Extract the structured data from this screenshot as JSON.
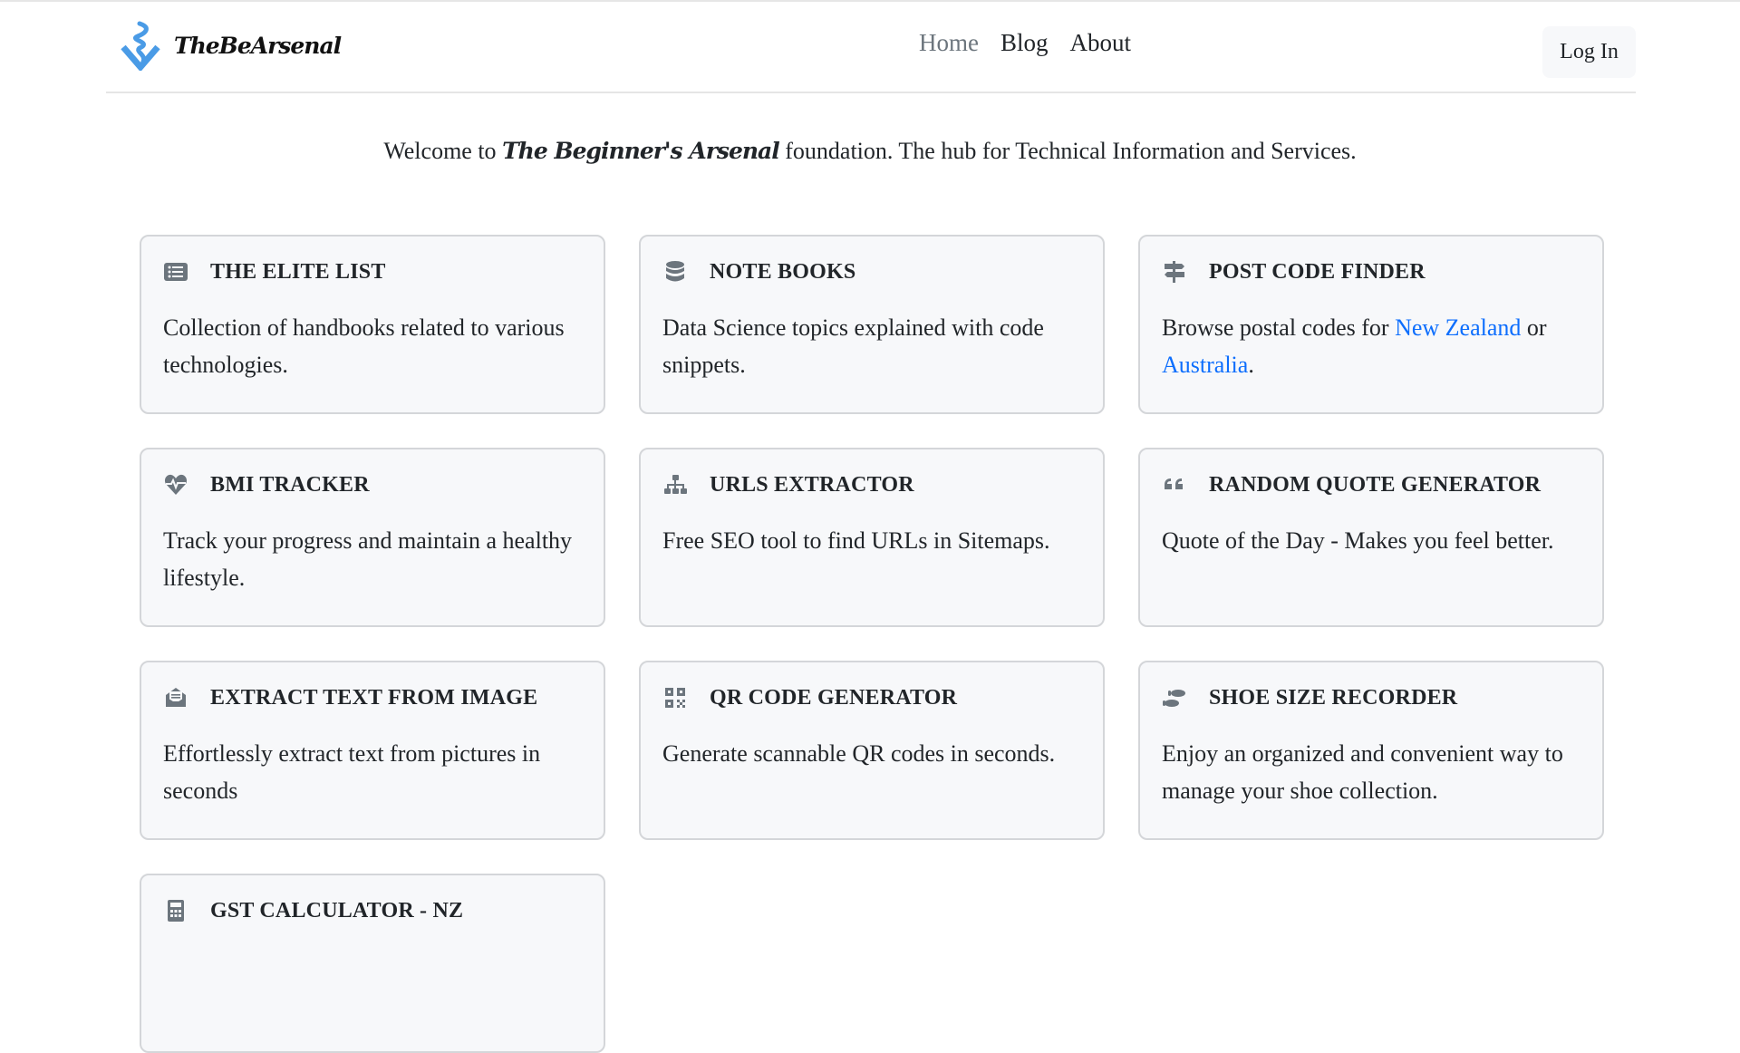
{
  "header": {
    "brand_name": "TheBeArsenal",
    "nav": [
      {
        "label": "Home",
        "active": true
      },
      {
        "label": "Blog",
        "active": false
      },
      {
        "label": "About",
        "active": false
      }
    ],
    "login_label": "Log In"
  },
  "welcome": {
    "prefix": "Welcome to ",
    "emphasis": "The Beginner's Arsenal",
    "suffix": " foundation. The hub for Technical Information and Services."
  },
  "colors": {
    "brand_blue": "#4a9be6",
    "link_blue": "#0d6efd",
    "icon_gray": "#6c757d",
    "card_bg": "#f7f8fa"
  },
  "cards": [
    {
      "title": "THE ELITE LIST",
      "icon": "list-icon",
      "body": "Collection of handbooks related to various technologies."
    },
    {
      "title": "NOTE BOOKS",
      "icon": "database-icon",
      "body": "Data Science topics explained with code snippets."
    },
    {
      "title": "POST CODE FINDER",
      "icon": "signpost-icon",
      "body_prefix": "Browse postal codes for ",
      "link1": "New Zealand",
      "body_mid": " or ",
      "link2": "Australia",
      "body_suffix": "."
    },
    {
      "title": "BMI TRACKER",
      "icon": "heart-pulse-icon",
      "body": "Track your progress and maintain a healthy lifestyle."
    },
    {
      "title": "URLS EXTRACTOR",
      "icon": "sitemap-icon",
      "body": "Free SEO tool to find URLs in Sitemaps."
    },
    {
      "title": "RANDOM QUOTE GENERATOR",
      "icon": "quote-icon",
      "body": "Quote of the Day - Makes you feel better."
    },
    {
      "title": "EXTRACT TEXT FROM IMAGE",
      "icon": "envelope-open-text-icon",
      "body": "Effortlessly extract text from pictures in seconds"
    },
    {
      "title": "QR CODE GENERATOR",
      "icon": "qrcode-icon",
      "body": "Generate scannable QR codes in seconds."
    },
    {
      "title": "SHOE SIZE RECORDER",
      "icon": "shoe-prints-icon",
      "body": "Enjoy an organized and convenient way to manage your shoe collection."
    },
    {
      "title": "GST CALCULATOR - NZ",
      "icon": "calculator-icon",
      "body": ""
    }
  ]
}
